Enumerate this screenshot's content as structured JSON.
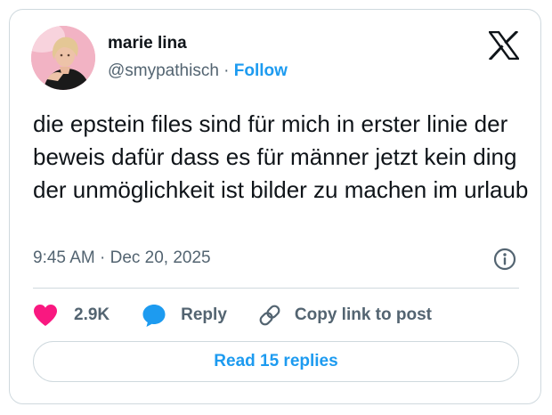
{
  "author": {
    "display_name": "marie lina",
    "handle": "@smypathisch",
    "separator": "·",
    "follow_label": "Follow"
  },
  "tweet": {
    "text": "die epstein files sind für mich in erster linie der beweis dafür dass es für männer jetzt kein ding der unmöglichkeit ist bilder zu machen im urlaub",
    "timestamp": "9:45 AM · Dec 20, 2025"
  },
  "actions": {
    "like_count": "2.9K",
    "reply_label": "Reply",
    "copy_link_label": "Copy link to post"
  },
  "read_replies_label": "Read 15 replies",
  "icons": {
    "brand": "x-logo-icon",
    "info": "info-icon",
    "like": "heart-icon",
    "reply": "reply-bubble-icon",
    "copy_link": "link-icon"
  },
  "colors": {
    "accent": "#1d9bf0",
    "like": "#f91880",
    "text_primary": "#0f1419",
    "text_secondary": "#536471",
    "border": "#cfd9de"
  }
}
